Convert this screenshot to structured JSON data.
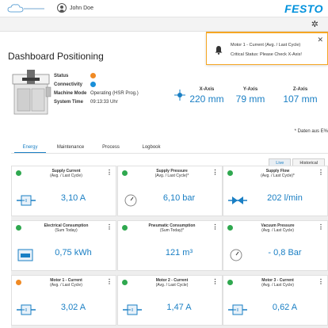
{
  "header": {
    "user_name": "John Doe",
    "brand": "FESTO"
  },
  "page": {
    "title": "Dashboard Positioning",
    "note": "* Daten aus E%"
  },
  "notification": {
    "title": "Motor 1 - Current (Avg. / Last Cycle)",
    "message": "Critical Status: Please Check X-Axis!"
  },
  "machine_info": {
    "status_label": "Status",
    "connectivity_label": "Connectivity",
    "mode_label": "Machine Mode",
    "mode_value": "Operating (HSR Prog.)",
    "time_label": "System Time",
    "time_value": "09:13:33 Uhr",
    "status_color": "#f08a24",
    "connectivity_color": "#1a8fd8"
  },
  "axes": [
    {
      "label": "X-Axis",
      "value": "220 mm"
    },
    {
      "label": "Y-Axis",
      "value": "79 mm"
    },
    {
      "label": "Z-Axis",
      "value": "107 mm"
    }
  ],
  "tabs": [
    "Energy",
    "Maintenance",
    "Process",
    "Logbook"
  ],
  "toggle": [
    "Live",
    "Historical"
  ],
  "cards": [
    {
      "title": "Supply Current",
      "subtitle": "(Avg. / Last Cycle)",
      "value": "3,10 A",
      "icon": "power-supply-icon",
      "status_color": "#2fa84f"
    },
    {
      "title": "Supply Pressure",
      "subtitle": "(Avg. / Last Cycle)*",
      "value": "6,10 bar",
      "icon": "pressure-gauge-icon",
      "status_color": "#2fa84f"
    },
    {
      "title": "Supply Flow",
      "subtitle": "(Avg. / Last Cycle)*",
      "value": "202 l/min",
      "icon": "flow-icon",
      "status_color": "#2fa84f"
    },
    {
      "title": "Electrical Consumption",
      "subtitle": "(Sum Today)",
      "value": "0,75 kWh",
      "icon": "energy-meter-icon",
      "status_color": "#2fa84f"
    },
    {
      "title": "Pneumatic Consumption",
      "subtitle": "(Sum Today)*",
      "value": "121 m³",
      "icon": "none",
      "status_color": "#2fa84f"
    },
    {
      "title": "Vacuum Pressure",
      "subtitle": "(Avg. / Last Cycle)",
      "value": "- 0,8 Bar",
      "icon": "pressure-gauge-icon",
      "status_color": "#2fa84f"
    },
    {
      "title": "Motor 1 - Current",
      "subtitle": "(Avg. / Last Cycle)",
      "value": "3,02 A",
      "icon": "power-supply-icon",
      "status_color": "#f08a24"
    },
    {
      "title": "Motor 2 - Current",
      "subtitle": "(Avg. / Last Cycle)",
      "value": "1,47 A",
      "icon": "power-supply-icon",
      "status_color": "#2fa84f"
    },
    {
      "title": "Motor 3 - Current",
      "subtitle": "(Avg. / Last Cycle)",
      "value": "0,62 A",
      "icon": "power-supply-icon",
      "status_color": "#2fa84f"
    }
  ]
}
